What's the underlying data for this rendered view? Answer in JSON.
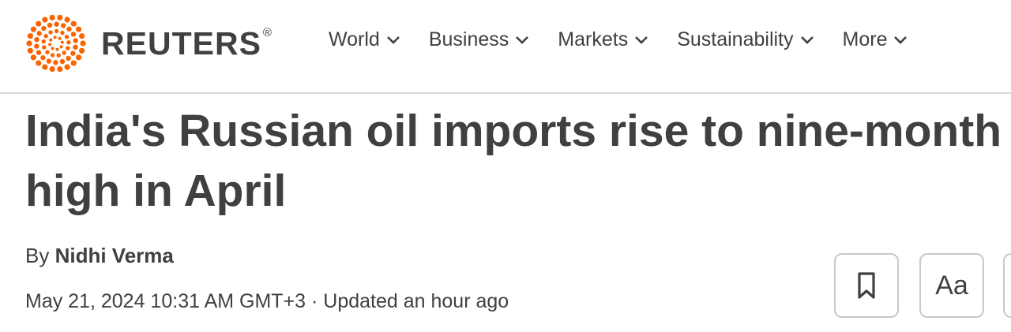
{
  "brand": {
    "name": "REUTERS",
    "registered_mark": "®",
    "accent_color": "#fa6400"
  },
  "nav": {
    "items": [
      {
        "label": "World",
        "icon": "chevron-down-icon"
      },
      {
        "label": "Business",
        "icon": "chevron-down-icon"
      },
      {
        "label": "Markets",
        "icon": "chevron-down-icon"
      },
      {
        "label": "Sustainability",
        "icon": "chevron-down-icon"
      },
      {
        "label": "More",
        "icon": "chevron-down-icon"
      }
    ]
  },
  "article": {
    "headline_line1": "India's Russian oil imports rise to nine-month",
    "headline_line2": "high in April",
    "byline_prefix": "By",
    "author": "Nidhi Verma",
    "dateline": "May 21, 2024 10:31 AM GMT+3 · Updated an hour ago"
  },
  "tools": {
    "bookmark_icon": "bookmark-icon",
    "text_size_label": "Aa"
  }
}
